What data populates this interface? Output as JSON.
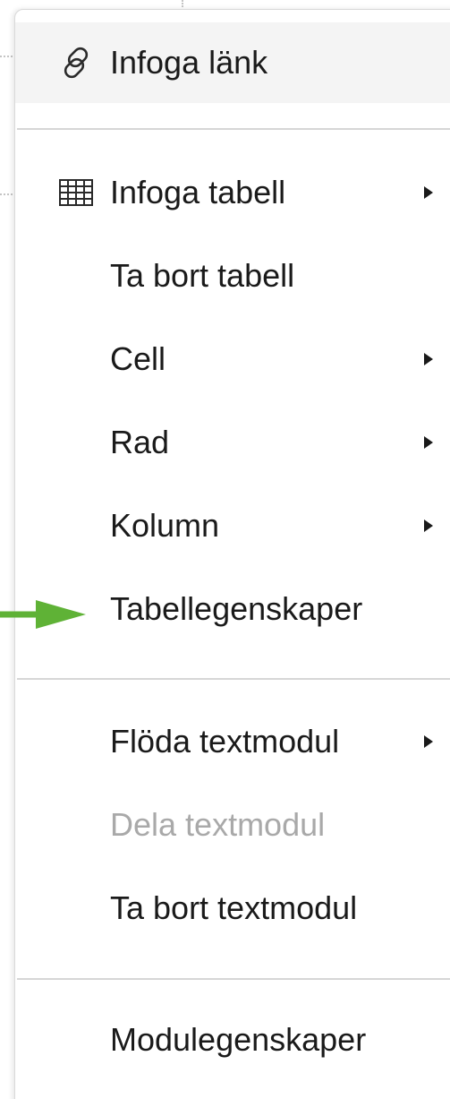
{
  "menu": {
    "items": [
      {
        "label": "Infoga länk",
        "icon": "link-icon",
        "submenu": false,
        "enabled": true,
        "highlighted": true
      },
      {
        "label": "Infoga tabell",
        "icon": "table-icon",
        "submenu": true,
        "enabled": true
      },
      {
        "label": "Ta bort tabell",
        "submenu": false,
        "enabled": true
      },
      {
        "label": "Cell",
        "submenu": true,
        "enabled": true
      },
      {
        "label": "Rad",
        "submenu": true,
        "enabled": true
      },
      {
        "label": "Kolumn",
        "submenu": true,
        "enabled": true
      },
      {
        "label": "Tabellegenskaper",
        "submenu": false,
        "enabled": true
      },
      {
        "label": "Flöda textmodul",
        "submenu": true,
        "enabled": true
      },
      {
        "label": "Dela textmodul",
        "submenu": false,
        "enabled": false
      },
      {
        "label": "Ta bort textmodul",
        "submenu": false,
        "enabled": true
      },
      {
        "label": "Modulegenskaper",
        "submenu": false,
        "enabled": true
      }
    ]
  },
  "colors": {
    "annotation_arrow": "#5fb236",
    "highlight_background": "#f4f4f4",
    "disabled_text": "#a9a9a9",
    "separator": "#d6d6d6"
  }
}
